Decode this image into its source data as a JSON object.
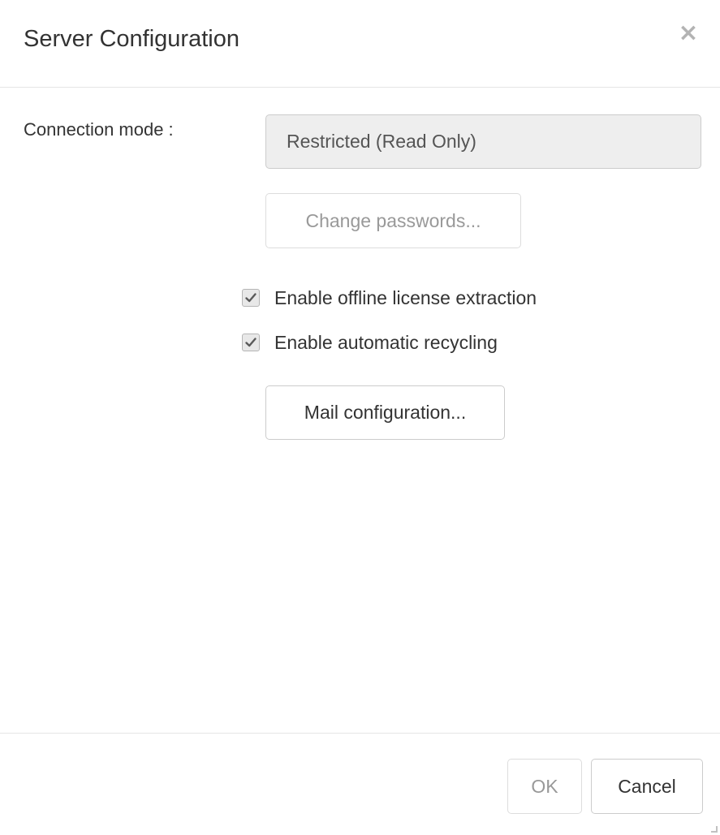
{
  "dialog": {
    "title": "Server Configuration",
    "close_glyph": "×"
  },
  "connection": {
    "label": "Connection mode :",
    "mode_value": "Restricted (Read Only)"
  },
  "buttons": {
    "change_passwords": "Change passwords...",
    "mail_configuration": "Mail configuration...",
    "ok": "OK",
    "cancel": "Cancel"
  },
  "options": [
    {
      "label": "Enable offline license extraction",
      "checked": true
    },
    {
      "label": "Enable automatic recycling",
      "checked": true
    }
  ],
  "icons": {
    "close": "close-icon",
    "check": "checkmark-icon",
    "resize": "resize-grip-icon"
  },
  "colors": {
    "text": "#333333",
    "muted": "#999999",
    "field_bg": "#eeeeee",
    "border": "#cccccc"
  }
}
